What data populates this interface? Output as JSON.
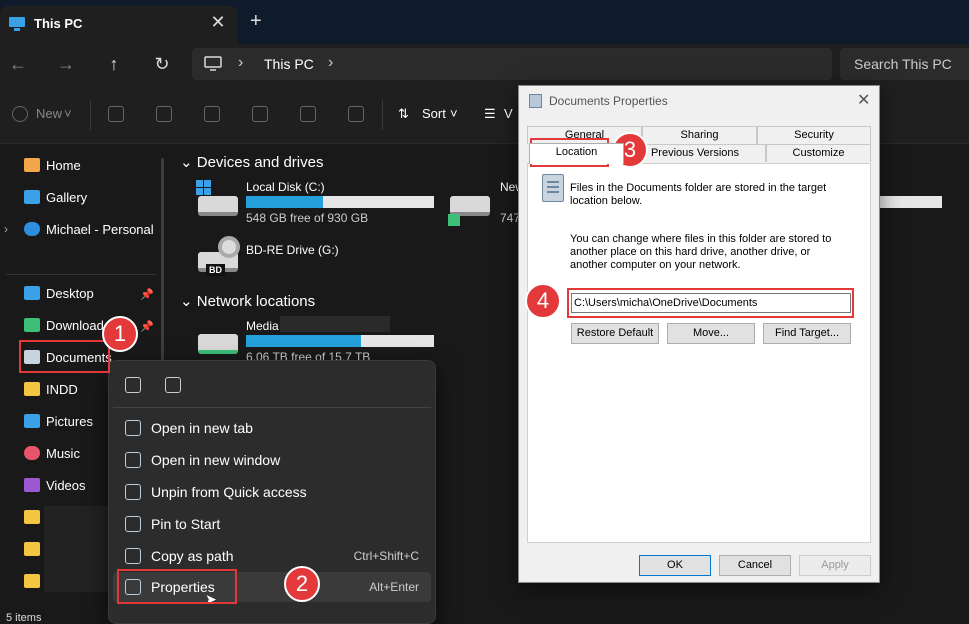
{
  "window": {
    "tab_title": "This PC",
    "close_symbol": "✕",
    "new_tab_symbol": "+"
  },
  "nav": {
    "back": "←",
    "forward": "→",
    "up": "↑",
    "refresh": "↻",
    "breadcrumb": [
      "This PC"
    ],
    "search_placeholder": "Search This PC"
  },
  "commands": {
    "new_label": "New",
    "sort_label": "Sort",
    "view_label": "V"
  },
  "sidebar": {
    "items": [
      {
        "label": "Home",
        "icon": "home-icon"
      },
      {
        "label": "Gallery",
        "icon": "gallery-icon"
      },
      {
        "label": "Michael - Personal",
        "icon": "onedrive-icon"
      },
      {
        "label": "Desktop",
        "icon": "desktop-icon"
      },
      {
        "label": "Download",
        "icon": "download-icon"
      },
      {
        "label": "Documents",
        "icon": "documents-icon"
      },
      {
        "label": "INDD",
        "icon": "folder-icon"
      },
      {
        "label": "Pictures",
        "icon": "pictures-icon"
      },
      {
        "label": "Music",
        "icon": "music-icon"
      },
      {
        "label": "Videos",
        "icon": "videos-icon"
      }
    ]
  },
  "content": {
    "devices_heading": "Devices and drives",
    "network_heading": "Network locations",
    "drives": [
      {
        "name": "Local Disk (C:)",
        "free": "548 GB free of 930 GB",
        "used_fraction": 0.41
      },
      {
        "name": "New",
        "free": "747",
        "used_fraction": 0.5
      },
      {
        "name": "BD-RE Drive (G:)",
        "free": "",
        "badge": "BD"
      }
    ],
    "network": [
      {
        "name": "Media",
        "free": "6.06 TB free of 15.7 TB",
        "used_fraction": 0.61
      }
    ]
  },
  "context_menu": {
    "items": [
      {
        "label": "Open in new tab",
        "shortcut": ""
      },
      {
        "label": "Open in new window",
        "shortcut": ""
      },
      {
        "label": "Unpin from Quick access",
        "shortcut": ""
      },
      {
        "label": "Pin to Start",
        "shortcut": ""
      },
      {
        "label": "Copy as path",
        "shortcut": "Ctrl+Shift+C"
      },
      {
        "label": "Properties",
        "shortcut": "Alt+Enter"
      }
    ]
  },
  "status": {
    "items": "5 items"
  },
  "dialog": {
    "title": "Documents Properties",
    "tabs_top": [
      "General",
      "Sharing",
      "Security"
    ],
    "tabs_bottom": [
      "Location",
      "Previous Versions",
      "Customize"
    ],
    "text1": "Files in the Documents folder are stored in the target location below.",
    "text2": "You can change where files in this folder are stored to another place on this hard drive, another drive, or another computer on your network.",
    "path": "C:\\Users\\micha\\OneDrive\\Documents",
    "buttons": [
      "Restore Default",
      "Move...",
      "Find Target..."
    ],
    "footer": [
      "OK",
      "Cancel",
      "Apply"
    ]
  },
  "annotations": [
    "1",
    "2",
    "3",
    "4"
  ],
  "colors": {
    "accent": "#26a0da",
    "annotation": "#e3393b"
  }
}
